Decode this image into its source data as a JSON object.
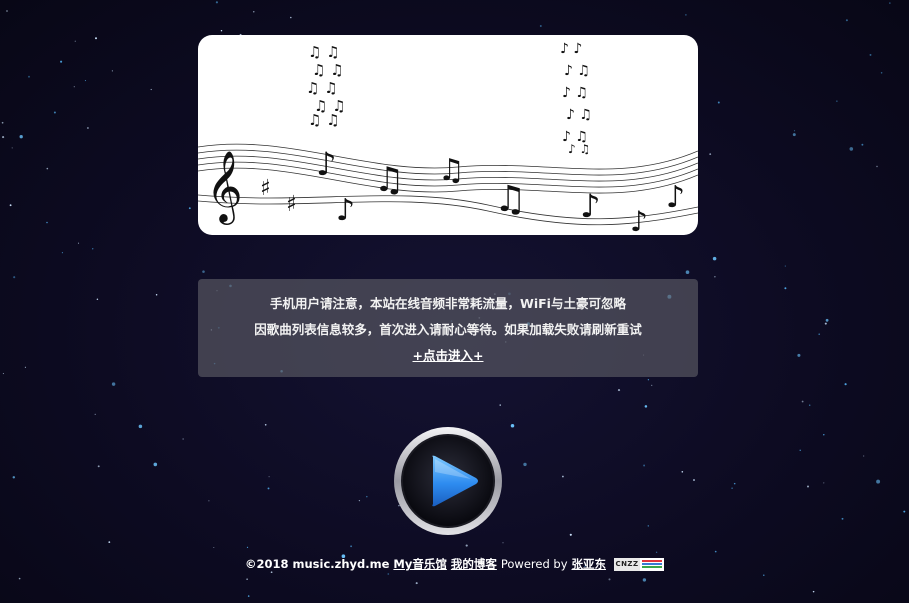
{
  "notice": {
    "line1": "手机用户请注意，本站在线音频非常耗流量，WiFi与土豪可忽略",
    "line2": "因歌曲列表信息较多，首次进入请耐心等待。如果加载失败请刷新重试",
    "enter_link": "+点击进入+"
  },
  "footer": {
    "copyright": "©2018 music.zhyd.me",
    "my_music_link": "My音乐馆",
    "blog_link": "我的博客",
    "powered_by": "Powered by",
    "author_link": "张亚东",
    "cnzz_badge": "CNZZ"
  },
  "icons": {
    "play": "play-icon",
    "banner": "music-notes-illustration"
  },
  "colors": {
    "background": "#0c0a1e",
    "play_blue": "#3a9bff",
    "notice_bg": "#555560"
  }
}
